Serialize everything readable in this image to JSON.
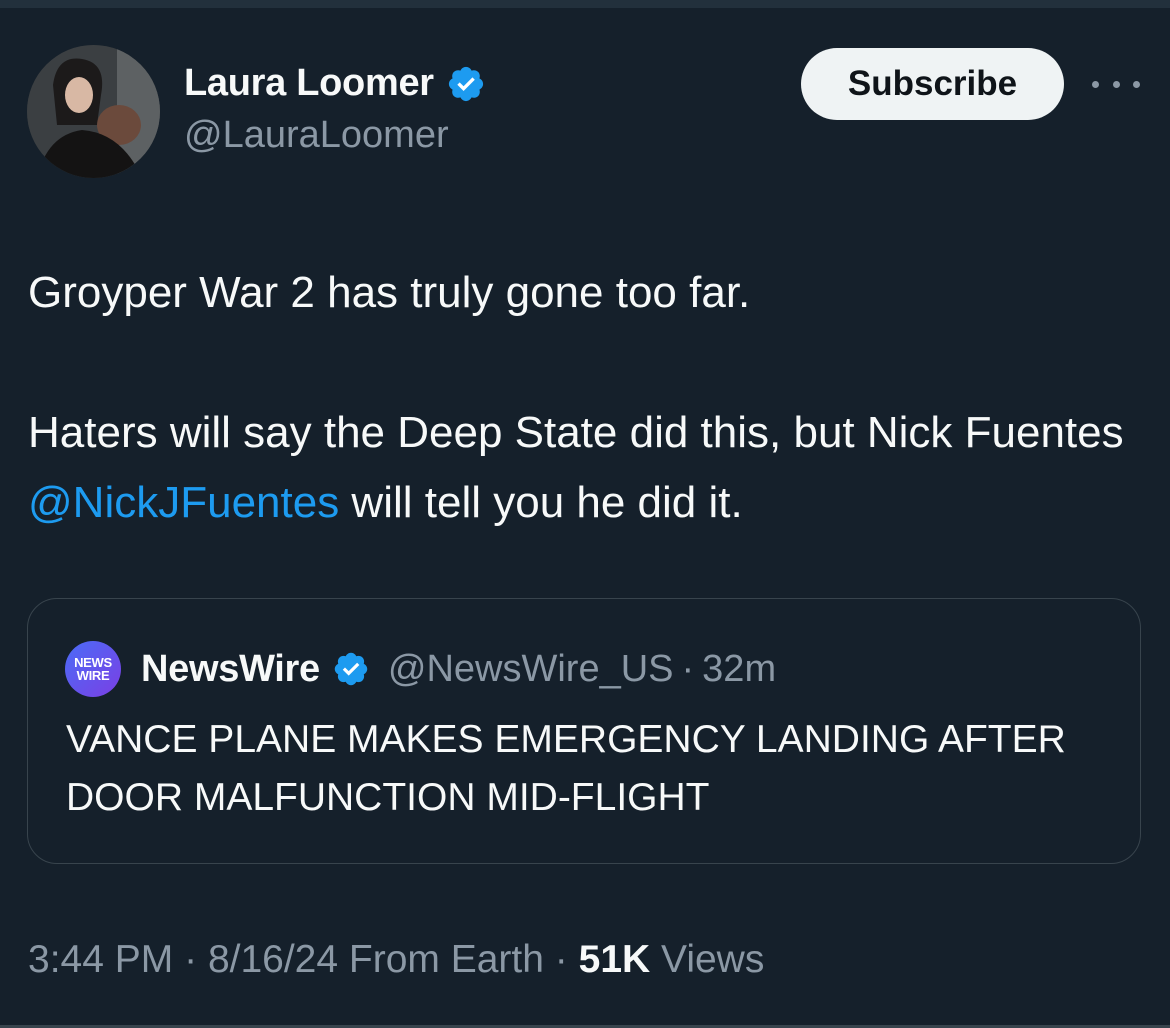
{
  "author": {
    "display_name": "Laura Loomer",
    "handle": "@LauraLoomer",
    "verified": true,
    "subscribe_label": "Subscribe",
    "more_label": "•••"
  },
  "tweet": {
    "line1": "Groyper War 2 has truly gone too far.",
    "line2_before": "Haters will say the Deep State did this, but Nick Fuentes ",
    "mention": "@NickJFuentes",
    "line2_after": " will tell you he did it."
  },
  "quoted": {
    "logo_top": "NEWS",
    "logo_bottom": "WIRE",
    "display_name": "NewsWire",
    "handle": "@NewsWire_US",
    "separator": "·",
    "time": "32m",
    "text": "VANCE PLANE MAKES EMERGENCY LANDING AFTER DOOR MALFUNCTION MID-FLIGHT"
  },
  "meta": {
    "time": "3:44 PM",
    "sep1": "·",
    "date_location": "8/16/24 From Earth",
    "sep2": "·",
    "views_count": "51K",
    "views_label": "Views"
  },
  "colors": {
    "background": "#15202b",
    "accent": "#1d9bf0",
    "muted": "#8b98a5",
    "text": "#f7f9f9"
  }
}
